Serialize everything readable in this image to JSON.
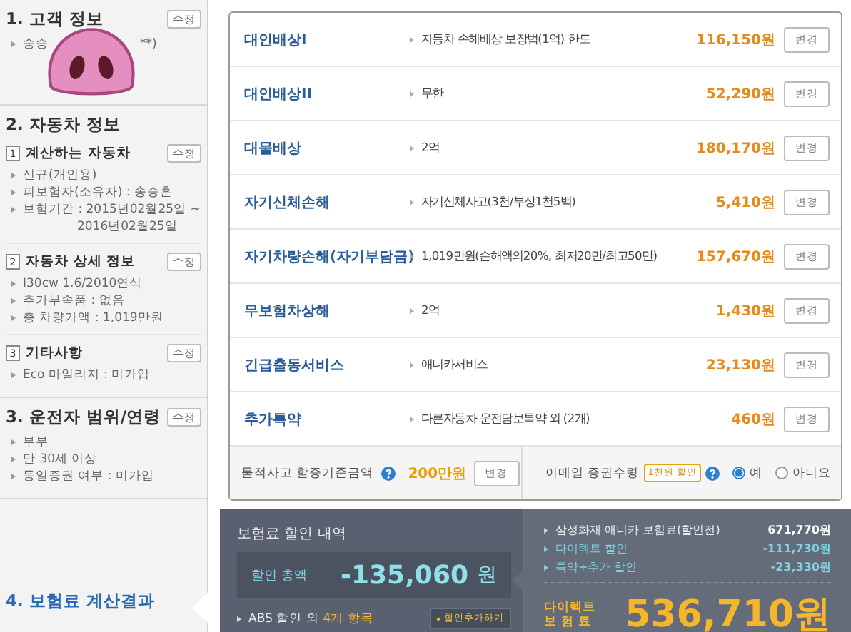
{
  "sidebar": {
    "sections": [
      {
        "title": "1. 고객 정보",
        "edit": "수정",
        "selected": false,
        "items": [
          {
            "text": "송승",
            "kind": "bullet"
          }
        ],
        "covered_tail": "**)"
      },
      {
        "title": "2. 자동차 정보",
        "selected": false,
        "subsections": [
          {
            "number": "1",
            "title": "계산하는 자동차",
            "edit": "수정",
            "items": [
              {
                "text": "신규(개인용)",
                "kind": "bullet"
              },
              {
                "text": "피보험자(소유자) : 송승훈",
                "kind": "bullet"
              },
              {
                "text": "보험기간 : 2015년02월25일 ~",
                "kind": "bullet"
              },
              {
                "text": "2016년02월25일",
                "kind": "continuation"
              }
            ]
          },
          {
            "number": "2",
            "title": "자동차 상세 정보",
            "edit": "수정",
            "items": [
              {
                "text": "I30cw 1.6/2010연식",
                "kind": "bullet"
              },
              {
                "text": "추가부속품 : 없음",
                "kind": "bullet"
              },
              {
                "text": "총 차량가액 : 1,019만원",
                "kind": "bullet"
              }
            ]
          },
          {
            "number": "3",
            "title": "기타사항",
            "edit": "수정",
            "items": [
              {
                "text": "Eco 마일리지 : 미가입",
                "kind": "bullet"
              }
            ]
          }
        ]
      },
      {
        "title": "3. 운전자 범위/연령",
        "edit": "수정",
        "selected": false,
        "items": [
          {
            "text": "부부",
            "kind": "bullet"
          },
          {
            "text": "만 30세 이상",
            "kind": "bullet"
          },
          {
            "text": "동일증권 여부 : 미가입",
            "kind": "bullet"
          }
        ]
      },
      {
        "title": "4. 보험료 계산결과",
        "selected": true
      }
    ]
  },
  "coverages": [
    {
      "name": "대인배상I",
      "detail": "자동차 손해배상 보장법(1억) 한도",
      "price": "116,150원",
      "button": "변경"
    },
    {
      "name": "대인배상II",
      "detail": "무한",
      "price": "52,290원",
      "button": "변경"
    },
    {
      "name": "대물배상",
      "detail": "2억",
      "price": "180,170원",
      "button": "변경"
    },
    {
      "name": "자기신체손해",
      "detail": "자기신체사고(3천/부상1천5백)",
      "price": "5,410원",
      "button": "변경"
    },
    {
      "name": "자기차량손해(자기부담금)",
      "detail": "1,019만원(손해액의20%, 최저20만/최고50만)",
      "price": "157,670원",
      "button": "변경"
    },
    {
      "name": "무보험차상해",
      "detail": "2억",
      "price": "1,430원",
      "button": "변경"
    },
    {
      "name": "긴급출동서비스",
      "detail": "애니카서비스",
      "price": "23,130원",
      "button": "변경"
    },
    {
      "name": "추가특약",
      "detail": "다른자동차 운전담보특약 외 (2개)",
      "price": "460원",
      "button": "변경"
    }
  ],
  "options": {
    "threshold": {
      "label": "물적사고 할증기준금액",
      "value": "200만원",
      "button": "변경"
    },
    "email": {
      "label": "이메일 증권수령",
      "badge": "1천원 할인",
      "radios": [
        {
          "label": "예",
          "selected": true
        },
        {
          "label": "아니요",
          "selected": false
        }
      ]
    }
  },
  "discount": {
    "title": "보험료 할인 내역",
    "total_label": "할인 총액",
    "total_value": "-135,060",
    "total_unit": "원",
    "abs_prefix": "ABS 할인 외",
    "abs_count": "4개 항목",
    "add_button": "할인추가하기"
  },
  "summary": {
    "lines": [
      {
        "label": "삼성화재 애니카 보험료(할인전)",
        "value": "671,770원",
        "kind": "base"
      },
      {
        "label": "다이렉트 할인",
        "value": "-111,730원",
        "kind": "discount"
      },
      {
        "label": "특약+추가 할인",
        "value": "-23,330원",
        "kind": "discount"
      }
    ],
    "final_label": [
      "다이렉트",
      "보 험 료"
    ],
    "final_value": "536,710원"
  }
}
